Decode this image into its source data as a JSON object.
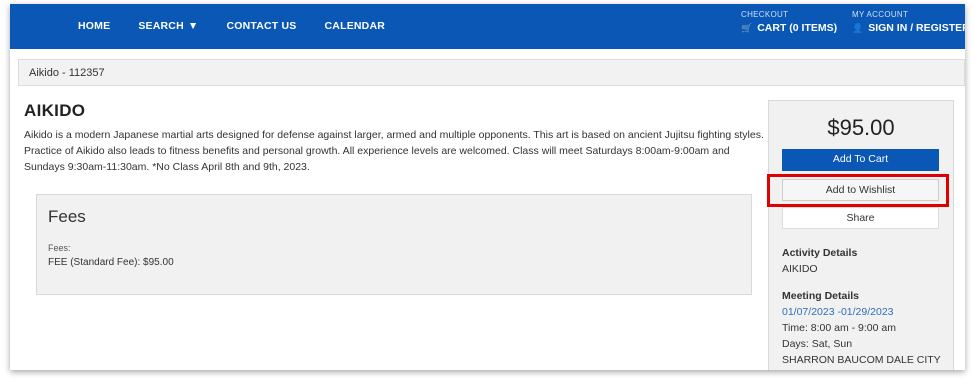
{
  "nav": {
    "items": [
      {
        "label": "HOME"
      },
      {
        "label": "SEARCH",
        "caret": "▼"
      },
      {
        "label": "CONTACT US"
      },
      {
        "label": "CALENDAR"
      }
    ]
  },
  "account": {
    "checkout_caption": "CHECKOUT",
    "cart_label": "CART (0 ITEMS)",
    "my_account_caption": "MY ACCOUNT",
    "signin_label": "SIGN IN / REGISTER",
    "cart_icon": "cart-icon",
    "user_icon": "user-icon"
  },
  "breadcrumb": "Aikido - 112357",
  "activity": {
    "title": "AIKIDO",
    "description": "Aikido is a modern Japanese martial arts designed for defense against larger, armed and multiple opponents. This art is based on ancient Jujitsu fighting styles. Practice of Aikido also leads to fitness benefits and personal growth. All experience levels are welcomed. Class will meet Saturdays 8:00am-9:00am and Sundays 9:30am-11:30am. *No Class April 8th and 9th, 2023."
  },
  "fees": {
    "heading": "Fees",
    "label": "Fees:",
    "line": "FEE (Standard Fee): $95.00"
  },
  "sidebar": {
    "price": "$95.00",
    "add_to_cart": "Add To Cart",
    "add_to_wishlist": "Add to Wishlist",
    "share": "Share",
    "activity_details_heading": "Activity Details",
    "activity_details_value": "AIKIDO",
    "meeting_details_heading": "Meeting Details",
    "meeting_dates": "01/07/2023 -01/29/2023",
    "time": "Time: 8:00 am - 9:00 am",
    "days": "Days: Sat, Sun",
    "location": "SHARRON BAUCOM DALE CITY"
  },
  "colors": {
    "brand_blue": "#0a57b5",
    "highlight": "#e00000",
    "link_blue": "#2d6fb8"
  }
}
